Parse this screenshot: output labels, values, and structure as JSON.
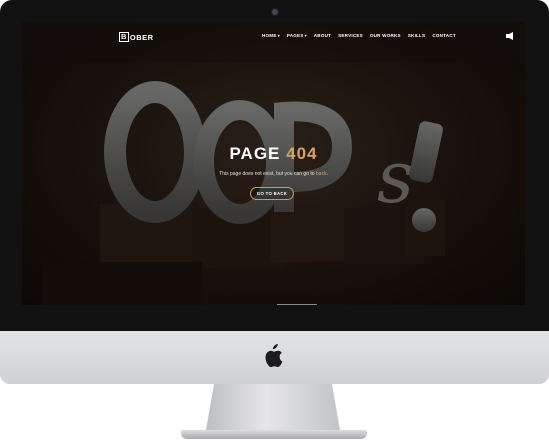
{
  "header": {
    "logo_text": "BOBER",
    "logo_boxed_letter": "B",
    "logo_rest": "OBER",
    "nav": [
      {
        "label": "HOME",
        "has_caret": true
      },
      {
        "label": "PAGES",
        "has_caret": true
      },
      {
        "label": "ABOUT",
        "has_caret": false
      },
      {
        "label": "SERVICES",
        "has_caret": false
      },
      {
        "label": "OUR WORKS",
        "has_caret": false
      },
      {
        "label": "SKILLS",
        "has_caret": false
      },
      {
        "label": "CONTACT",
        "has_caret": false
      }
    ],
    "caret_glyph": "▾"
  },
  "hero": {
    "background_letters": "OOPs!",
    "title_prefix": "PAGE",
    "title_code": "404",
    "message_prefix": "This page does not exist, but you can go to",
    "message_link": "back",
    "message_suffix": ".",
    "button_label": "GO TO BACK"
  },
  "colors": {
    "accent": "#d0a46b",
    "bezel": "#111112",
    "chin": "#dcdde0"
  },
  "icons": {
    "nav_right": "menu-toggle-icon",
    "chin_logo": "apple-icon"
  }
}
